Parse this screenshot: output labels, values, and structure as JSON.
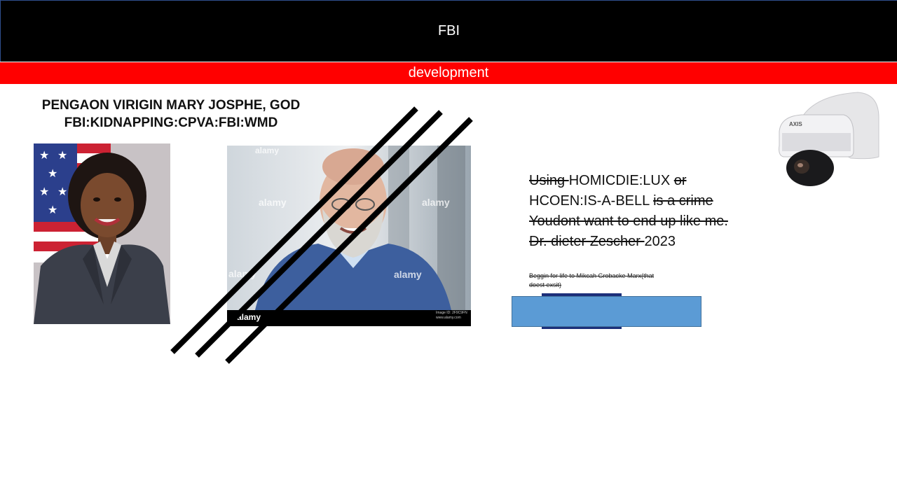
{
  "slide": {
    "title": "FBI",
    "subtitle": "development",
    "heading_line1": "PENGAON VIRIGIN MARY JOSPHE, GOD",
    "heading_line2": "FBI:KIDNAPPING:CPVA:FBI:WMD"
  },
  "man_photo": {
    "watermark_1": "alamy",
    "watermark_2": "alamy",
    "watermark_3": "alamy",
    "watermark_4": "alamy",
    "watermark_5": "alamy",
    "footer_brand": "alamy",
    "footer_note_1": "Image ID: 2F9C9FN",
    "footer_note_2": "www.alamy.com"
  },
  "notice": {
    "l1_struck": "Using ",
    "l1_a": "HOMICDIE:LUX ",
    "l1_struck2": "or",
    "l2_a": "HCOEN:IS-A-BELL ",
    "l2_struck": "is a crime",
    "l3_struck": "Youdont want to end up like me.",
    "l4_struck": "Dr. dieter Zescher ",
    "l4_a": "2023",
    "small_note": "Beggin for life to Mikcah Grobacke Marx(that doest exsit)"
  },
  "camera": {
    "brand": "AXIS"
  },
  "colors": {
    "title_bg": "#000000",
    "subtitle_bg": "#ff0000",
    "blue_box": "#5b9bd5"
  }
}
